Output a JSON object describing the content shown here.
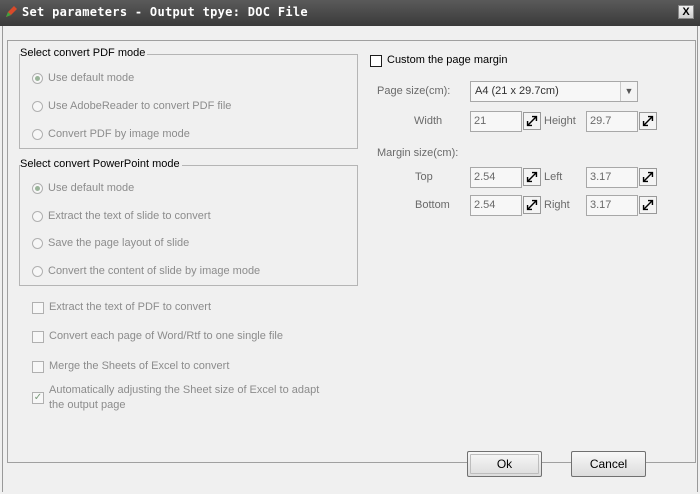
{
  "window": {
    "title": "Set parameters - Output tpye: DOC File",
    "close_label": "X"
  },
  "pdf_group": {
    "title": "Select convert PDF mode",
    "options": [
      "Use default mode",
      "Use AdobeReader to convert PDF file",
      "Convert PDF by image mode"
    ],
    "selected_index": 0
  },
  "ppt_group": {
    "title": "Select convert PowerPoint mode",
    "options": [
      "Use default mode",
      "Extract the text of slide to convert",
      "Save the page layout of slide",
      "Convert the content of slide by image mode"
    ],
    "selected_index": 0
  },
  "checks": [
    {
      "label": "Extract the text of PDF to convert",
      "checked": false
    },
    {
      "label": "Convert each page of Word/Rtf to one single file",
      "checked": false
    },
    {
      "label": "Merge the Sheets of Excel to convert",
      "checked": false
    },
    {
      "label_line1": "Automatically adjusting the Sheet size of Excel to adapt",
      "label_line2": "the output page",
      "checked": true
    }
  ],
  "margin": {
    "custom_label": "Custom the page margin",
    "custom_checked": false,
    "page_size_label": "Page size(cm):",
    "page_size_value": "A4 (21 x 29.7cm)",
    "width_label": "Width",
    "width_value": "21",
    "height_label": "Height",
    "height_value": "29.7",
    "margin_size_label": "Margin size(cm):",
    "top_label": "Top",
    "top_value": "2.54",
    "left_label": "Left",
    "left_value": "3.17",
    "bottom_label": "Bottom",
    "bottom_value": "2.54",
    "right_label": "Right",
    "right_value": "3.17"
  },
  "buttons": {
    "ok": "Ok",
    "cancel": "Cancel"
  },
  "icons": {
    "app": "pencil-icon",
    "spin": "spin-arrows-icon",
    "dropdown": "chevron-down-icon"
  }
}
